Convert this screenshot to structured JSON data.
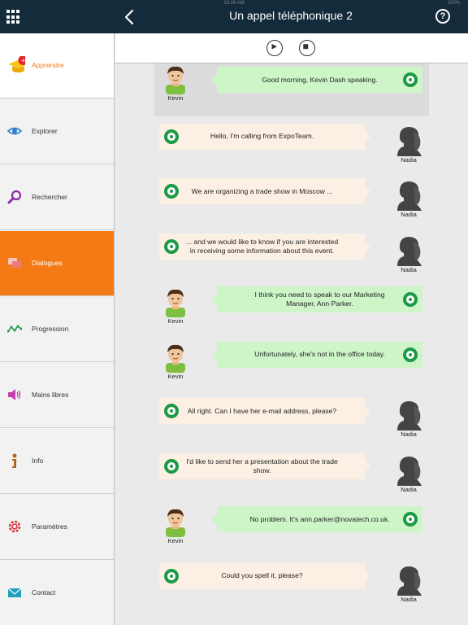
{
  "status": {
    "time": "10:26 AM",
    "battery": "100%"
  },
  "header": {
    "title": "Un appel téléphonique 2"
  },
  "sidebar": {
    "items": [
      {
        "label": "Apprendre",
        "icon": "graduation-cap-icon"
      },
      {
        "label": "Explorer",
        "icon": "eye-icon"
      },
      {
        "label": "Rechercher",
        "icon": "magnifier-icon"
      },
      {
        "label": "Dialogues",
        "icon": "chat-icon"
      },
      {
        "label": "Progression",
        "icon": "progress-graph-icon"
      },
      {
        "label": "Mains libres",
        "icon": "speaker-icon"
      },
      {
        "label": "Info",
        "icon": "info-icon"
      },
      {
        "label": "Paramètres",
        "icon": "gear-icon"
      },
      {
        "label": "Contact",
        "icon": "envelope-icon"
      }
    ]
  },
  "speakers": {
    "kevin": "Kevin",
    "nadia": "Nadia"
  },
  "colors": {
    "accent": "#f47a16",
    "header": "#142b3b",
    "kevin_bubble": "#cdf5c8",
    "nadia_bubble": "#fbf0e3",
    "ring": "#1d9a47"
  },
  "dialogue": [
    {
      "speaker": "kevin",
      "text": "Good morning, Kevin Dash speaking."
    },
    {
      "speaker": "nadia",
      "text": "Hello, I'm calling from ExpoTeam."
    },
    {
      "speaker": "nadia",
      "text": "We are organizing a trade show in Moscow ..."
    },
    {
      "speaker": "nadia",
      "text": "... and we would like to know if you are interested in receiving some information about this event."
    },
    {
      "speaker": "kevin",
      "text": "I think you need to speak to our Marketing Manager, Ann Parker."
    },
    {
      "speaker": "kevin",
      "text": "Unfortunately, she's not in the office today."
    },
    {
      "speaker": "nadia",
      "text": "All right. Can I have her e-mail address, please?"
    },
    {
      "speaker": "nadia",
      "text": "I'd like to send her a presentation about the trade show."
    },
    {
      "speaker": "kevin",
      "text": "No problem. It's ann.parker@novatech.co.uk."
    },
    {
      "speaker": "nadia",
      "text": "Could you spell it, please?"
    }
  ]
}
